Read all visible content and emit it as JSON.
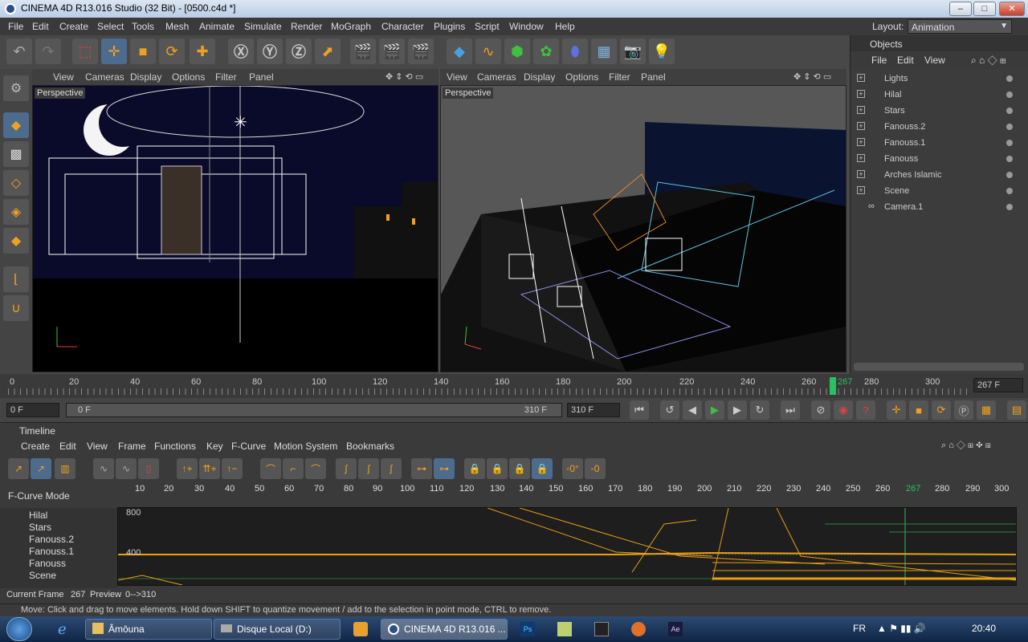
{
  "window": {
    "title": "CINEMA 4D R13.016 Studio (32 Bit) - [0500.c4d *]",
    "minimize": "–",
    "maximize": "□",
    "close": "✕"
  },
  "menu": [
    "File",
    "Edit",
    "Create",
    "Select",
    "Tools",
    "Mesh",
    "Simulate",
    "Animate",
    "Simulate",
    "Render",
    "MoGraph",
    "Character",
    "Plugins",
    "Script",
    "Window",
    "Help"
  ],
  "layout": {
    "label": "Layout:",
    "value": "Animation"
  },
  "viewport_menu": [
    "View",
    "Cameras",
    "Display",
    "Options",
    "Filter",
    "Panel"
  ],
  "viewports": [
    {
      "label": "Perspective"
    },
    {
      "label": "Perspective"
    }
  ],
  "objects": {
    "title": "Objects",
    "menu": [
      "File",
      "Edit",
      "View"
    ],
    "items": [
      "Lights",
      "Hilal",
      "Stars",
      "Fanouss.2",
      "Fanouss.1",
      "Fanouss",
      "Arches Islamic",
      "Scene",
      "Camera.1"
    ]
  },
  "ruler": {
    "ticks": [
      "0",
      "20",
      "40",
      "60",
      "80",
      "100",
      "120",
      "140",
      "160",
      "180",
      "200",
      "220",
      "240",
      "260",
      "280",
      "300"
    ],
    "current": "267",
    "frame_field": "267 F"
  },
  "transport": {
    "start": "0 F",
    "range_start": "0 F",
    "range_end": "310 F",
    "end": "310 F"
  },
  "timeline": {
    "title": "Timeline",
    "menu": [
      "Create",
      "Edit",
      "View",
      "Frame",
      "Functions",
      "Key",
      "F-Curve",
      "Motion System",
      "Bookmarks"
    ],
    "mode": "F-Curve Mode",
    "ticks": [
      "10",
      "20",
      "30",
      "40",
      "50",
      "60",
      "70",
      "80",
      "90",
      "100",
      "110",
      "120",
      "130",
      "140",
      "150",
      "160",
      "170",
      "180",
      "190",
      "200",
      "210",
      "220",
      "230",
      "240",
      "250",
      "260",
      "267",
      "280",
      "290",
      "300"
    ],
    "y_labels": [
      "800",
      "400"
    ],
    "tracks": [
      "Hilal",
      "Stars",
      "Fanouss.2",
      "Fanouss.1",
      "Fanouss",
      "Scene"
    ],
    "current_frame_label": "Current Frame",
    "current_frame": "267",
    "preview_label": "Preview",
    "preview_range": "0-->310"
  },
  "status": "Move: Click and drag to move elements. Hold down SHIFT to quantize movement / add to the selection in point mode, CTRL to remove.",
  "taskbar": {
    "items": [
      "Âmôuna",
      "Disque Local (D:)",
      "CINEMA 4D R13.016 ..."
    ],
    "lang": "FR",
    "clock": "20:40"
  }
}
